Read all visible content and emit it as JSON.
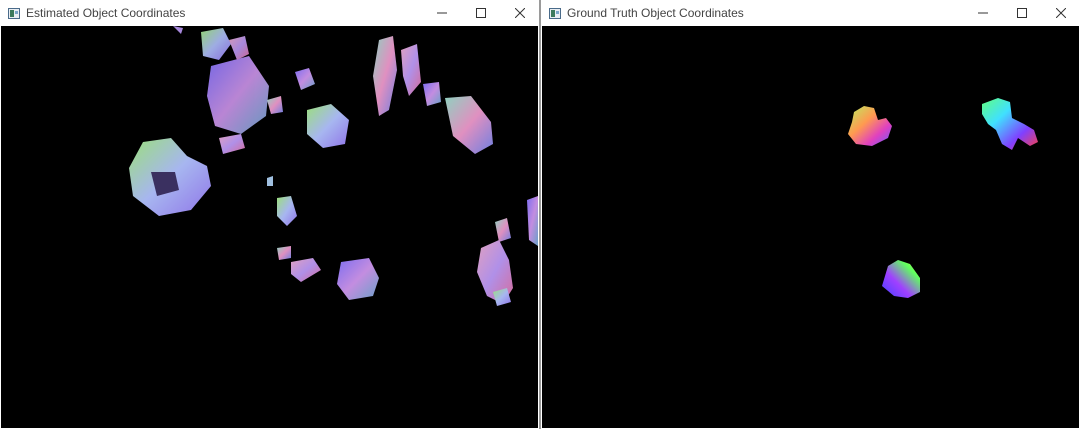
{
  "windows": [
    {
      "id": "left",
      "title": "Estimated Object Coordinates",
      "controls": {
        "minimize": "minimize-icon",
        "maximize": "maximize-icon",
        "close": "close-icon"
      }
    },
    {
      "id": "right",
      "title": "Ground Truth Object Coordinates",
      "controls": {
        "minimize": "minimize-icon",
        "maximize": "maximize-icon",
        "close": "close-icon"
      }
    }
  ],
  "colors": {
    "window_bg": "#ffffff",
    "canvas_bg": "#000000",
    "title_text": "#444444"
  }
}
